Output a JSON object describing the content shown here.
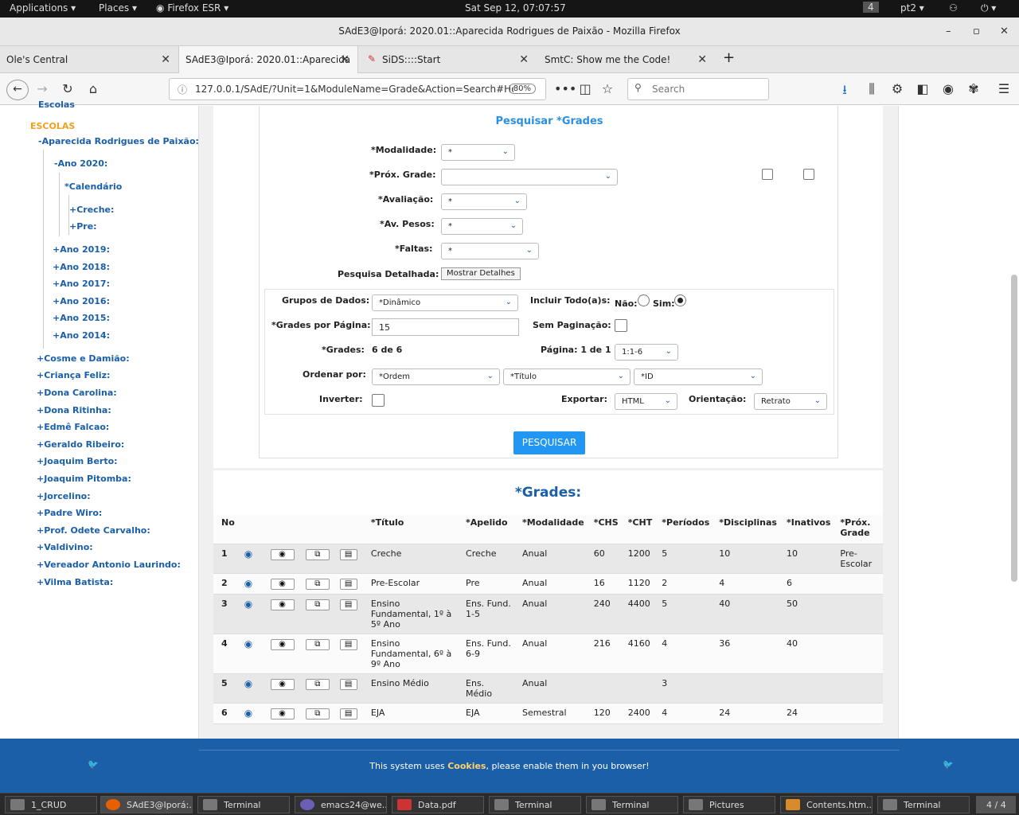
{
  "desktop": {
    "applications": "Applications",
    "places": "Places",
    "firefox": "Firefox ESR",
    "clock": "Sat Sep 12, 07:07:57",
    "workspace": "4",
    "lang": "pt2"
  },
  "window": {
    "title": "SAdE3@Iporá: 2020.01::Aparecida Rodrigues de Paixão - Mozilla Firefox"
  },
  "tabs": [
    {
      "label": "Ole's Central"
    },
    {
      "label": "SAdE3@Iporá: 2020.01::Aparecida"
    },
    {
      "label": "SiDS::::Start"
    },
    {
      "label": "SmtC: Show me the Code!"
    }
  ],
  "nav": {
    "url": "127.0.0.1/SAdE/?Unit=1&ModuleName=Grade&Action=Search#Ho",
    "zoom": "80%",
    "search_placeholder": "Search"
  },
  "sidebar": {
    "top_partial": "Escolas",
    "heading": "ESCOLAS",
    "school": "-Aparecida Rodrigues de Paixão:",
    "year_open": "-Ano 2020:",
    "calendar": "*Calendário",
    "sub": [
      "+Creche:",
      "+Pre:"
    ],
    "years": [
      "+Ano 2019:",
      "+Ano 2018:",
      "+Ano 2017:",
      "+Ano 2016:",
      "+Ano 2015:",
      "+Ano 2014:"
    ],
    "schools": [
      "+Cosme e Damião:",
      "+Criança Feliz:",
      "+Dona Carolina:",
      "+Dona Ritinha:",
      "+Edmê Falcao:",
      "+Geraldo Ribeiro:",
      "+Joaquim Berto:",
      "+Joaquim Pitomba:",
      "+Jorcelino:",
      "+Padre Wiro:",
      "+Prof. Odete Carvalho:",
      "+Valdivino:",
      "+Vereador Antonio Laurindo:",
      "+Vilma Batista:"
    ]
  },
  "search": {
    "title": "Pesquisar *Grades",
    "modalidade_label": "*Modalidade:",
    "modalidade_value": "*",
    "prox_label": "*Próx. Grade:",
    "prox_value": "",
    "avaliacao_label": "*Avaliação:",
    "avaliacao_value": "*",
    "pesos_label": "*Av. Pesos:",
    "pesos_value": "*",
    "faltas_label": "*Faltas:",
    "faltas_value": "*",
    "detalhada_label": "Pesquisa Detalhada:",
    "detalhes_button": "Mostrar Detalhes",
    "grupos_label": "Grupos de Dados:",
    "grupos_value": "*Dinâmico",
    "incluir_label": "Incluir Todo(a)s:",
    "nao": "Não:",
    "sim": "Sim:",
    "por_pagina_label": "*Grades por Página:",
    "por_pagina_value": "15",
    "sem_pag_label": "Sem Paginação:",
    "grades_label": "*Grades:",
    "grades_value": "6 de 6",
    "pagina_label": "Página: 1 de 1",
    "pagina_value": "1:1-6",
    "ordenar_label": "Ordenar por:",
    "ordem1": "*Ordem",
    "ordem2": "*Título",
    "ordem3": "*ID",
    "inverter_label": "Inverter:",
    "exportar_label": "Exportar:",
    "exportar_value": "HTML",
    "orientacao_label": "Orientação:",
    "orientacao_value": "Retrato",
    "submit": "PESQUISAR"
  },
  "grid": {
    "title": "*Grades:",
    "headers": [
      "No",
      "",
      "",
      "",
      "",
      "*Título",
      "*Apelido",
      "*Modalidade",
      "*CHS",
      "*CHT",
      "*Períodos",
      "*Disciplinas",
      "*Inativos",
      "*Próx. Grade"
    ],
    "rows": [
      [
        "1",
        "Creche",
        "Creche",
        "Anual",
        "60",
        "1200",
        "5",
        "10",
        "10",
        "Pre-Escolar"
      ],
      [
        "2",
        "Pre-Escolar",
        "Pre",
        "Anual",
        "16",
        "1120",
        "2",
        "4",
        "6",
        ""
      ],
      [
        "3",
        "Ensino Fundamental, 1º à 5º Ano",
        "Ens. Fund. 1-5",
        "Anual",
        "240",
        "4400",
        "5",
        "40",
        "50",
        ""
      ],
      [
        "4",
        "Ensino Fundamental, 6º à 9º Ano",
        "Ens. Fund. 6-9",
        "Anual",
        "216",
        "4160",
        "4",
        "36",
        "40",
        ""
      ],
      [
        "5",
        "Ensino Médio",
        "Ens. Médio",
        "Anual",
        "",
        "",
        "3",
        "",
        "",
        ""
      ],
      [
        "6",
        "EJA",
        "EJA",
        "Semestral",
        "120",
        "2400",
        "4",
        "24",
        "24",
        ""
      ]
    ]
  },
  "footer": {
    "pre": "This system uses ",
    "cookies": "Cookies",
    "post": ", please enable them in you browser!"
  },
  "taskbar": [
    {
      "label": "1_CRUD"
    },
    {
      "label": "SAdE3@Iporá:..."
    },
    {
      "label": "Terminal"
    },
    {
      "label": "emacs24@we..."
    },
    {
      "label": "Data.pdf"
    },
    {
      "label": "Terminal"
    },
    {
      "label": "Terminal"
    },
    {
      "label": "Pictures"
    },
    {
      "label": "Contents.htm..."
    },
    {
      "label": "Terminal"
    }
  ],
  "workspace_pager": "4 / 4"
}
